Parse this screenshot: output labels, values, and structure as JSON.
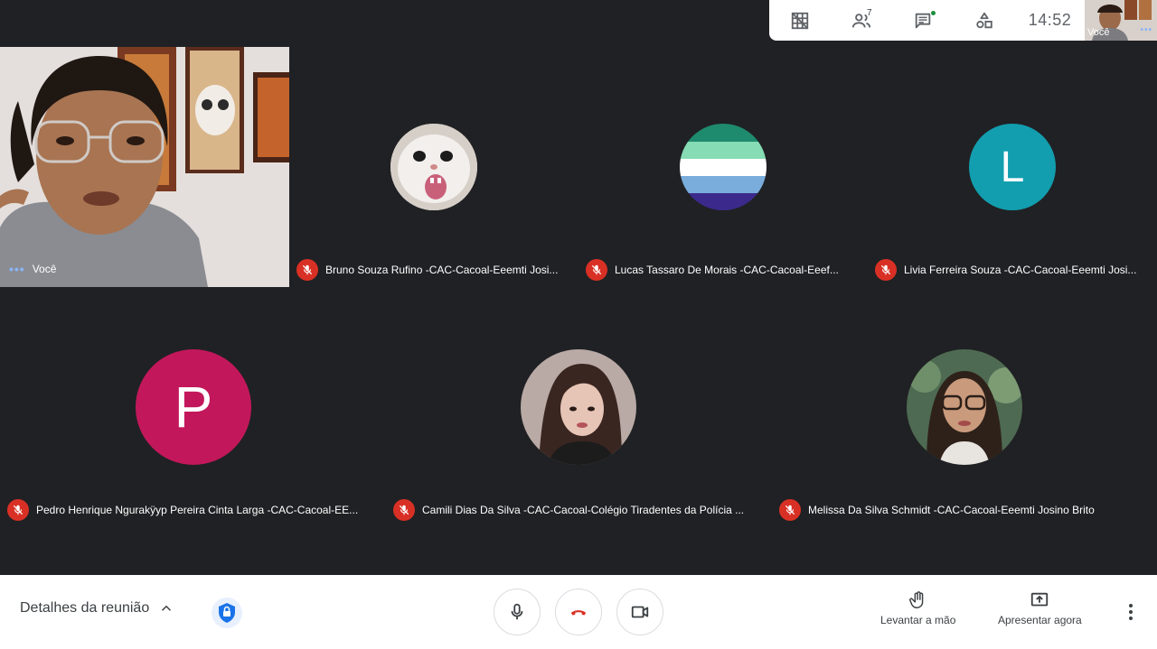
{
  "topbar": {
    "participant_count": "7",
    "clock": "14:52",
    "self_thumb_label": "Você",
    "icons": [
      "grid-icon",
      "people-icon",
      "chat-icon",
      "activities-icon"
    ]
  },
  "self_tile": {
    "label": "Você"
  },
  "participants": [
    {
      "name": "Bruno Souza Rufino -CAC-Cacoal-Eeemti Josi...",
      "avatar": "photo-cat"
    },
    {
      "name": "Lucas Tassaro De Morais -CAC-Cacoal-Eeef...",
      "avatar": "stripes"
    },
    {
      "name": "Livia Ferreira Souza -CAC-Cacoal-Eeemti Josi...",
      "avatar_letter": "L",
      "avatar_color": "#129eaf"
    },
    {
      "name": "Pedro Henrique Ngurakÿyp Pereira Cinta Larga -CAC-Cacoal-EE...",
      "avatar_letter": "P",
      "avatar_color": "#c2185b"
    },
    {
      "name": "Camili Dias Da Silva -CAC-Cacoal-Colégio Tiradentes da Polícia ...",
      "avatar": "photo-girl"
    },
    {
      "name": "Melissa Da Silva Schmidt -CAC-Cacoal-Eeemti Josino Brito",
      "avatar": "photo-girl-glasses"
    }
  ],
  "bottombar": {
    "details_label": "Detalhes da reunião",
    "raise_hand_label": "Levantar a mão",
    "present_label": "Apresentar agora"
  },
  "colors": {
    "mute_red": "#d93025",
    "hangup_red": "#d93025",
    "accent_blue": "#1a73e8"
  }
}
